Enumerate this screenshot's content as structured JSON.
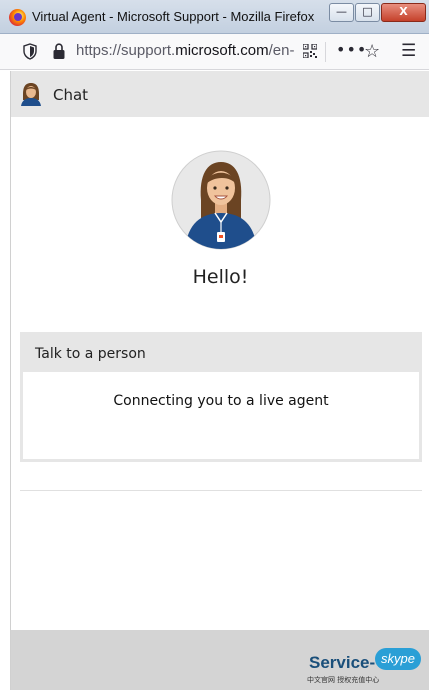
{
  "window": {
    "title": "Virtual Agent - Microsoft Support - Mozilla Firefox",
    "minimize": "—",
    "maximize": "□",
    "close": "X"
  },
  "navbar": {
    "url_prefix": "https://support.",
    "url_domain": "microsoft.com",
    "url_suffix": "/en-",
    "more": "•••",
    "bookmark": "☆",
    "menu": "☰"
  },
  "chat": {
    "header_label": "Chat",
    "greeting": "Hello!"
  },
  "card": {
    "title": "Talk to a person",
    "body": "Connecting you to a live agent"
  },
  "watermark": {
    "text": "Service-",
    "badge": "skype",
    "subtitle": "中文官网 授权充值中心"
  },
  "colors": {
    "header_bg": "#e6e6e6",
    "avatar_shirt": "#1f4e8c",
    "skype_blue": "#2a9fd6"
  }
}
